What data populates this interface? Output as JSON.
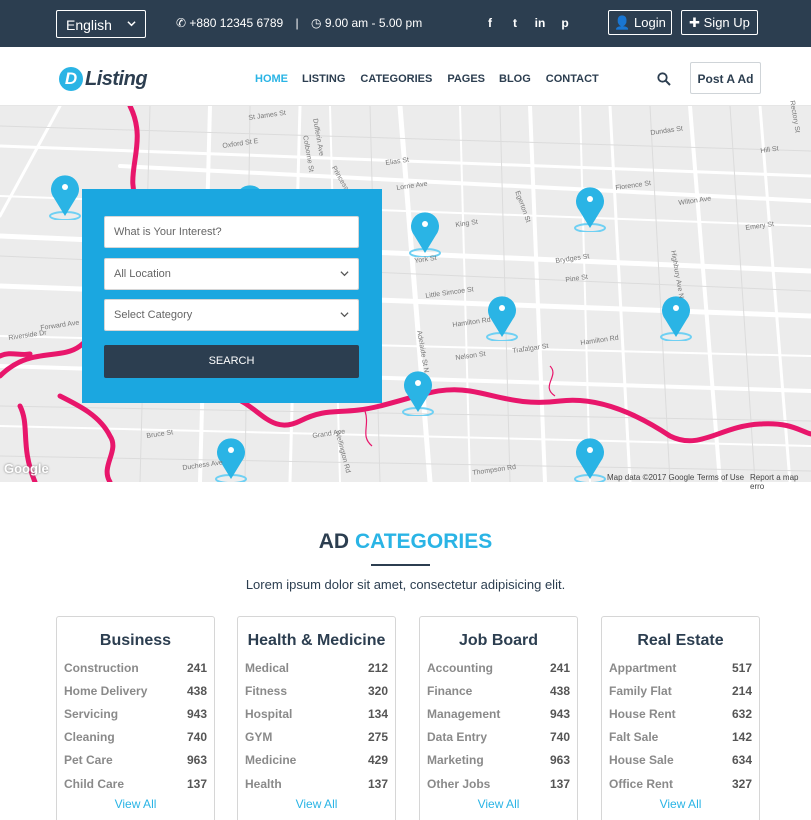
{
  "topbar": {
    "language": "English",
    "phone": "+880 12345 6789",
    "separator": "|",
    "hours": "9.00 am - 5.00 pm",
    "login_label": "Login",
    "signup_label": "Sign Up",
    "social_glyphs": {
      "facebook": "f",
      "twitter": "t",
      "linkedin": "in",
      "pinterest": "p"
    }
  },
  "brand": {
    "mark": "D",
    "name": "Listing"
  },
  "nav": {
    "items": [
      "HOME",
      "LISTING",
      "CATEGORIES",
      "PAGES",
      "BLOG",
      "CONTACT"
    ],
    "active_index": 0,
    "post_ad_label": "Post A Ad"
  },
  "search": {
    "interest_placeholder": "What is Your Interest?",
    "location_value": "All Location",
    "category_value": "Select Category",
    "button_label": "SEARCH"
  },
  "map": {
    "google_mark": "Google",
    "attribution": "Map data ©2017 Google",
    "terms": "Terms of Use",
    "report": "Report a map erro",
    "street_labels": [
      "Oxford St E",
      "St James St",
      "Colborne St",
      "Princess Ave",
      "Elias St",
      "Lorne Ave",
      "King St",
      "York St",
      "Little Simcoe St",
      "Hamilton Rd",
      "Trafalgar St",
      "Nelson St",
      "Grand Ave",
      "Bruce St",
      "Duchess Ave",
      "Thompson Rd",
      "Egerton St",
      "Pine St",
      "Brydges St",
      "Florence St",
      "Dundas St",
      "Rectory St",
      "Adelaide St N",
      "Wellington Rd",
      "Hamilton Rd",
      "Highbury Ave N",
      "Riverside Dr",
      "Forward Ave",
      "Dufferin Ave",
      "Wilton Ave",
      "Hill St",
      "Emery St"
    ]
  },
  "categories": {
    "title_main": "AD",
    "title_accent": "CATEGORIES",
    "subtitle": "Lorem ipsum dolor sit amet, consectetur adipisicing elit.",
    "view_all": "View All",
    "cards": [
      {
        "title": "Business",
        "rows": [
          {
            "name": "Construction",
            "count": "241"
          },
          {
            "name": "Home Delivery",
            "count": "438"
          },
          {
            "name": "Servicing",
            "count": "943"
          },
          {
            "name": "Cleaning",
            "count": "740"
          },
          {
            "name": "Pet Care",
            "count": "963"
          },
          {
            "name": "Child Care",
            "count": "137"
          }
        ]
      },
      {
        "title": "Health & Medicine",
        "rows": [
          {
            "name": "Medical",
            "count": "212"
          },
          {
            "name": "Fitness",
            "count": "320"
          },
          {
            "name": "Hospital",
            "count": "134"
          },
          {
            "name": "GYM",
            "count": "275"
          },
          {
            "name": "Medicine",
            "count": "429"
          },
          {
            "name": "Health",
            "count": "137"
          }
        ]
      },
      {
        "title": "Job Board",
        "rows": [
          {
            "name": "Accounting",
            "count": "241"
          },
          {
            "name": "Finance",
            "count": "438"
          },
          {
            "name": "Management",
            "count": "943"
          },
          {
            "name": "Data Entry",
            "count": "740"
          },
          {
            "name": "Marketing",
            "count": "963"
          },
          {
            "name": "Other Jobs",
            "count": "137"
          }
        ]
      },
      {
        "title": "Real Estate",
        "rows": [
          {
            "name": "Appartment",
            "count": "517"
          },
          {
            "name": "Family Flat",
            "count": "214"
          },
          {
            "name": "House Rent",
            "count": "632"
          },
          {
            "name": "Falt Sale",
            "count": "142"
          },
          {
            "name": "House Sale",
            "count": "634"
          },
          {
            "name": "Office Rent",
            "count": "327"
          }
        ]
      }
    ]
  },
  "colors": {
    "accent": "#2ab4e5",
    "dark": "#2c3e50",
    "river": "#e8166b",
    "search_bg": "#1ba7e0",
    "map_bg": "#ececec"
  }
}
